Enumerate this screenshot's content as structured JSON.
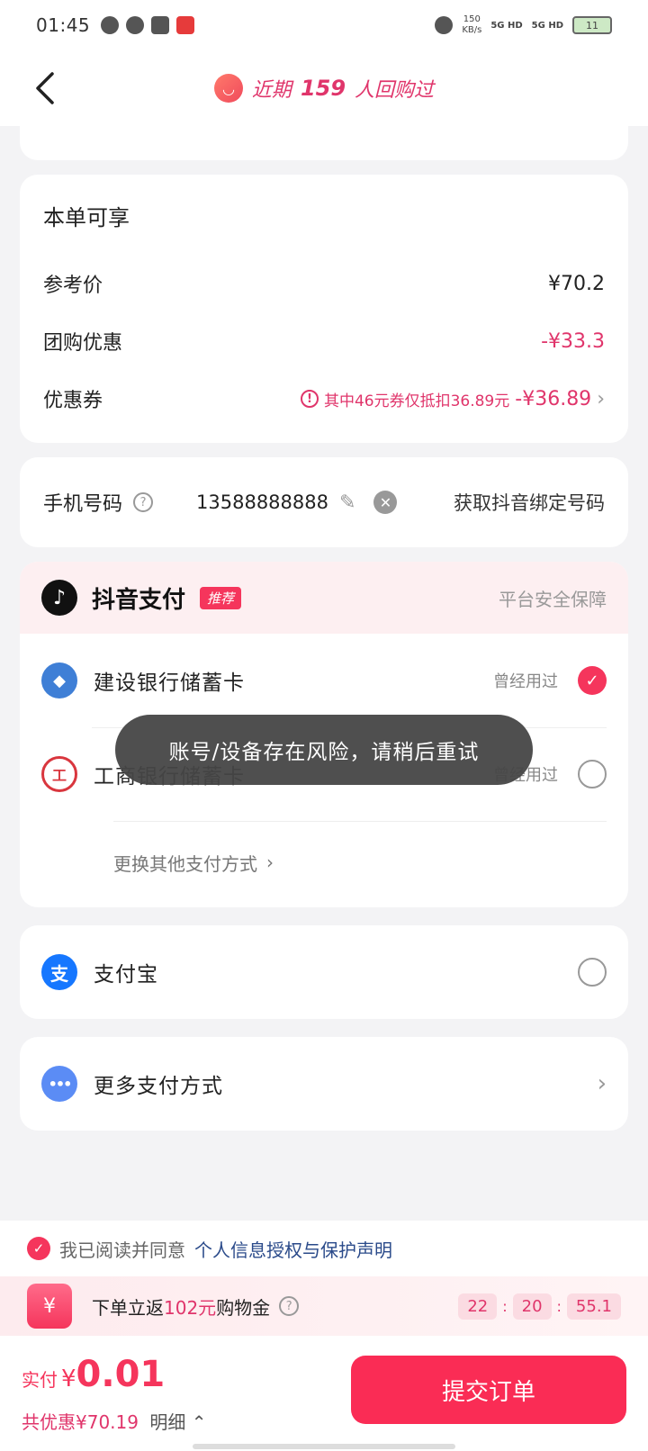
{
  "status_bar": {
    "time": "01:45",
    "net_speed_value": "150",
    "net_speed_unit": "KB/s",
    "signal_1": "5G HD",
    "signal_2": "5G HD",
    "battery": "11"
  },
  "nav": {
    "title_prefix": "近期",
    "title_count": "159",
    "title_suffix": "人回购过"
  },
  "summary": {
    "heading": "本单可享",
    "ref_price_label": "参考价",
    "ref_price_value": "¥70.2",
    "group_discount_label": "团购优惠",
    "group_discount_value": "-¥33.3",
    "coupon_label": "优惠券",
    "coupon_note": "其中46元券仅抵扣36.89元",
    "coupon_value": "-¥36.89"
  },
  "phone": {
    "label": "手机号码",
    "number": "13588888888",
    "get_bound": "获取抖音绑定号码"
  },
  "douyin_pay": {
    "title": "抖音支付",
    "badge": "推荐",
    "safety": "平台安全保障",
    "banks": [
      {
        "name": "建设银行储蓄卡",
        "tag": "曾经用过",
        "selected": true
      },
      {
        "name": "工商银行储蓄卡",
        "tag": "曾经用过",
        "selected": false
      }
    ],
    "switch_label": "更换其他支付方式"
  },
  "alipay": {
    "name": "支付宝"
  },
  "more_pay": {
    "name": "更多支付方式"
  },
  "agreement": {
    "prefix": "我已阅读并同意",
    "link": "个人信息授权与保护声明"
  },
  "promo": {
    "prefix": "下单立返",
    "amount": "102元",
    "suffix": "购物金",
    "timer_h": "22",
    "timer_m": "20",
    "timer_s": "55.1"
  },
  "bottom": {
    "pay_label": "实付",
    "currency": "¥",
    "amount": "0.01",
    "discount": "共优惠¥70.19",
    "detail": "明细",
    "submit": "提交订单"
  },
  "toast": {
    "message": "账号/设备存在风险，请稍后重试"
  },
  "colors": {
    "accent": "#fa2c55",
    "text_red": "#e0356b",
    "link": "#2a4a8a"
  }
}
